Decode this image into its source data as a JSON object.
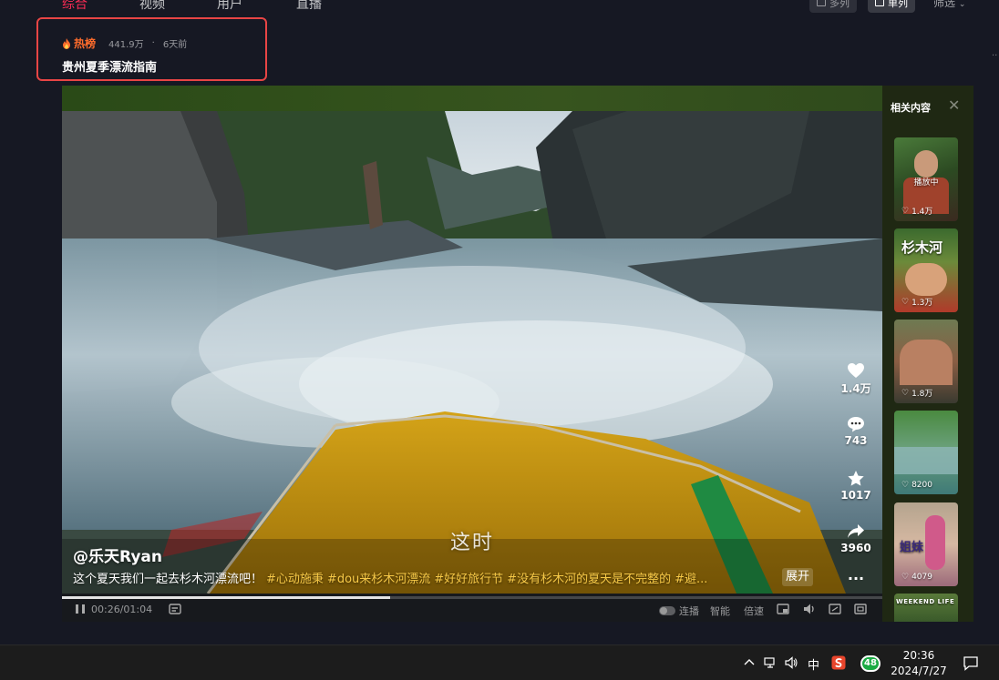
{
  "tabs": [
    {
      "label": "综合",
      "active": true
    },
    {
      "label": "视频",
      "active": false
    },
    {
      "label": "用户",
      "active": false
    },
    {
      "label": "直播",
      "active": false
    }
  ],
  "view_toggle": {
    "multi": "多列",
    "single": "单列",
    "filter": "筛选"
  },
  "hot_card": {
    "label": "热榜",
    "heat": "441.9万",
    "time": "6天前",
    "title": "贵州夏季漂流指南"
  },
  "video": {
    "subtitle": "这时",
    "author": "@乐天Ryan",
    "description": "这个夏天我们一起去杉木河漂流吧！",
    "hashtags": [
      "#心动施秉",
      "#dou来杉木河漂流",
      "#好好旅行节",
      "#没有杉木河的夏天是不完整的",
      "#避..."
    ],
    "expand": "展开",
    "actions": {
      "likes": "1.4万",
      "comments": "743",
      "favorites": "1017",
      "shares": "3960"
    },
    "progress": 0.4,
    "time_current": "00:26",
    "time_total": "01:04",
    "controls": {
      "autoplay": "连播",
      "smart": "智能",
      "speed": "倍速"
    }
  },
  "related": {
    "title": "相关内容",
    "playing_label": "播放中",
    "items": [
      {
        "likes": "1.4万",
        "playing": true,
        "overlay": ""
      },
      {
        "likes": "1.3万",
        "playing": false,
        "overlay": "杉木河"
      },
      {
        "likes": "1.8万",
        "playing": false,
        "overlay": ""
      },
      {
        "likes": "8200",
        "playing": false,
        "overlay": ""
      },
      {
        "likes": "4079",
        "playing": false,
        "overlay": "姐妹"
      },
      {
        "likes": "",
        "playing": false,
        "overlay": "WEEKEND LIFE"
      }
    ]
  },
  "taskbar": {
    "ime": "中",
    "badge": "48",
    "time": "20:36",
    "date": "2024/7/27"
  },
  "colors": {
    "accent": "#fe2c55",
    "hot": "#fe6c2c",
    "highlight_box": "#e84545",
    "hashtag": "#f7c947"
  }
}
